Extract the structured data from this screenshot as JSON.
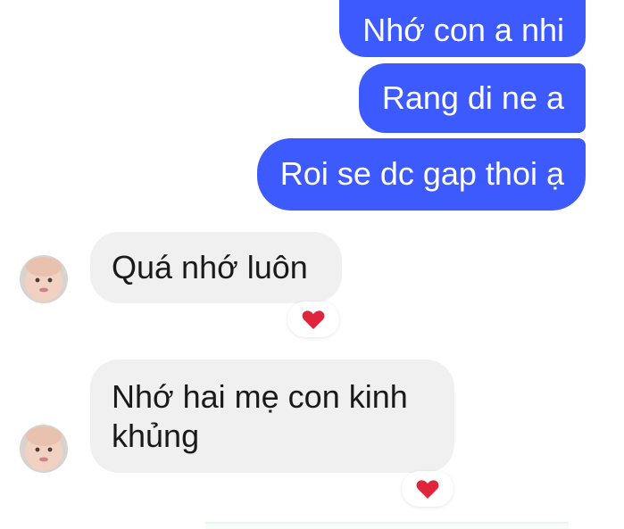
{
  "conversation": {
    "outgoing": [
      {
        "text": "Nhớ con a nhi"
      },
      {
        "text": "Rang di ne a"
      },
      {
        "text": "Roi se dc gap thoi ạ"
      }
    ],
    "incoming": [
      {
        "text": "Quá nhớ luôn",
        "reaction": "heart-icon"
      },
      {
        "line1": "Nhớ hai mẹ con kinh",
        "line2": "khủng",
        "reaction": "heart-icon"
      }
    ]
  },
  "colors": {
    "outgoing_bubble": "#3d5afe",
    "incoming_bubble": "#f0f0f0",
    "reaction_heart": "#e0243b"
  }
}
